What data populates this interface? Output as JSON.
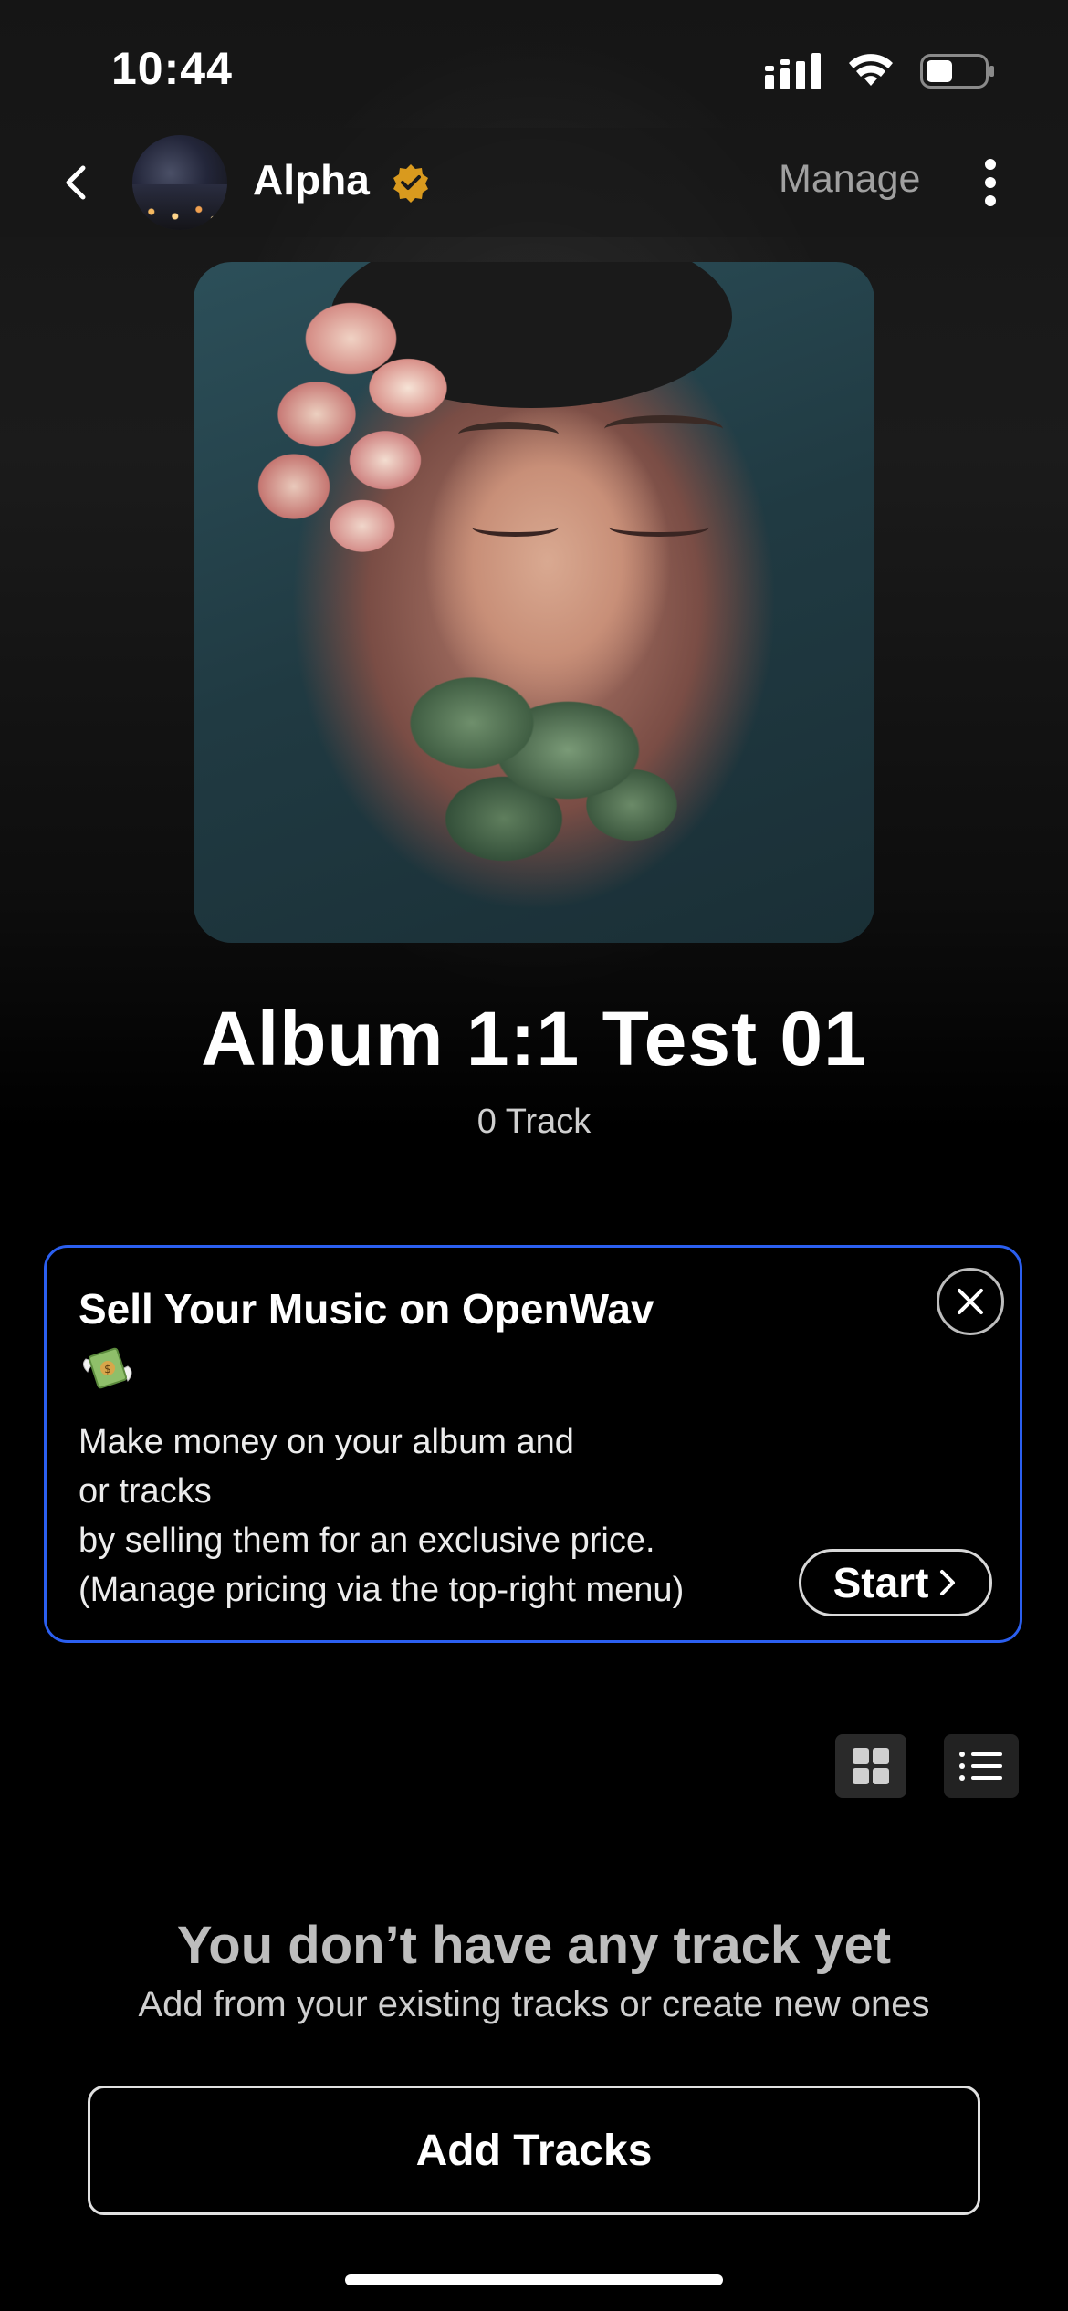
{
  "status_bar": {
    "time": "10:44",
    "icons": [
      "cellular-signal-icon",
      "wifi-icon",
      "battery-icon"
    ],
    "battery_level": 0.45
  },
  "nav": {
    "back_icon": "chevron-left-icon",
    "artist_name": "Alpha",
    "verified_icon": "verified-badge-icon",
    "manage_label": "Manage",
    "more_icon": "vertical-ellipsis-icon"
  },
  "album": {
    "title": "Album 1:1 Test 01",
    "track_count": "0 Track"
  },
  "promo": {
    "title": "Sell Your Music on OpenWav",
    "icon": "money-with-wings-icon",
    "body_lines": [
      "Make money on your album and",
      "or tracks",
      "by selling them for an exclusive price.",
      "(Manage pricing via the top-right menu)"
    ],
    "start_label": "Start",
    "border_color": "#2b5ff0"
  },
  "view_toggle": {
    "grid_icon": "grid-view-icon",
    "list_icon": "list-view-icon"
  },
  "empty_state": {
    "title": "You don’t have any track yet",
    "subtitle": "Add from your existing tracks or create new ones"
  },
  "add_tracks_label": "Add Tracks"
}
